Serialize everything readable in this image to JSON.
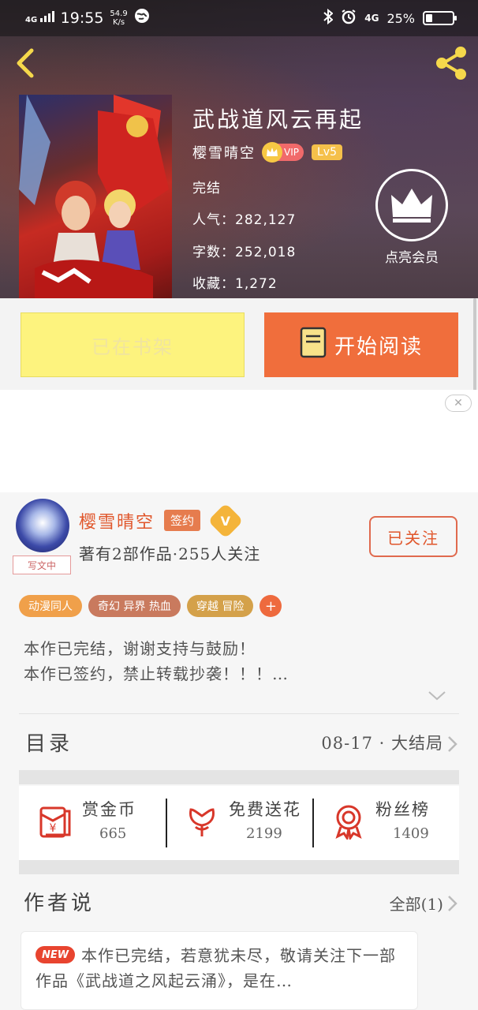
{
  "status_bar": {
    "network": "4G",
    "time": "19:55",
    "speed_value": "54.9",
    "speed_unit": "K/s",
    "mobile": "4G",
    "battery": "25%"
  },
  "book": {
    "title": "武战道风云再起",
    "author": "樱雪晴空",
    "vip": "VIP",
    "level": "Lv5",
    "status": "完结",
    "popularity_label": "人气：",
    "popularity": "282,127",
    "words_label": "字数：",
    "words": "252,018",
    "favorites_label": "收藏：",
    "favorites": "1,272",
    "member_label": "点亮会员"
  },
  "actions": {
    "shelf_label": "已在书架",
    "read_label": "开始阅读"
  },
  "author_card": {
    "name": "樱雪晴空",
    "sign_badge": "签约",
    "v_badge": "V",
    "writing_tag": "写文中",
    "works_line": "著有2部作品·255人关注",
    "follow_label": "已关注",
    "tags": [
      {
        "label": "动漫同人",
        "color": "#f0a04a"
      },
      {
        "label": "奇幻 异界 热血",
        "color": "#c97a5e"
      },
      {
        "label": "穿越 冒险",
        "color": "#d4a14a"
      },
      {
        "label": "+",
        "color": "#ee6a3e"
      }
    ],
    "desc_line1": "本作已完结，谢谢支持与鼓励！",
    "desc_line2": "本作已签约，禁止转载抄袭！！！…"
  },
  "toc": {
    "title": "目录",
    "latest": "08-17 · 大结局"
  },
  "stats": [
    {
      "label": "赏金币",
      "value": "665",
      "icon": "red-envelope-icon"
    },
    {
      "label": "免费送花",
      "value": "2199",
      "icon": "flower-icon"
    },
    {
      "label": "粉丝榜",
      "value": "1409",
      "icon": "medal-icon"
    }
  ],
  "author_says": {
    "title": "作者说",
    "all_label": "全部(1)",
    "new_badge": "NEW",
    "note": "本作已完结，若意犹未尽，敬请关注下一部作品《武战道之风起云涌》，是在…"
  },
  "colors": {
    "accent": "#f06e3c",
    "shelf_button": "#fdf37e",
    "author_name": "#e0562b"
  }
}
